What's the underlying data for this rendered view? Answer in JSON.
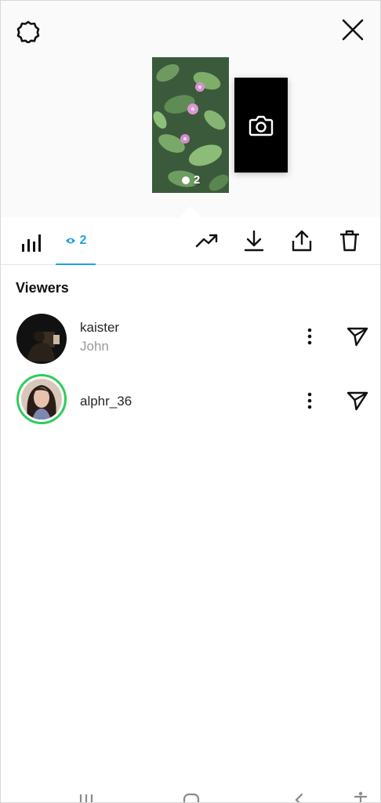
{
  "header": {
    "settings_icon": "settings-gear-icon",
    "close_icon": "close-icon"
  },
  "story": {
    "view_count": "2",
    "add_story_icon": "camera-icon"
  },
  "tabs": {
    "insights_icon": "bar-chart-icon",
    "viewers_count": "2",
    "viewers_icon": "eye-icon"
  },
  "actions": [
    "trend-icon",
    "download-icon",
    "share-icon",
    "trash-icon"
  ],
  "viewers": {
    "title": "Viewers",
    "items": [
      {
        "username": "kaister",
        "name": "John"
      },
      {
        "username": "alphr_36",
        "name": ""
      }
    ]
  },
  "colors": {
    "accent": "#1fa1e6",
    "story_ring": "#2ecc5a"
  },
  "system_nav": [
    "recents-icon",
    "home-icon",
    "back-icon",
    "accessibility-icon"
  ]
}
